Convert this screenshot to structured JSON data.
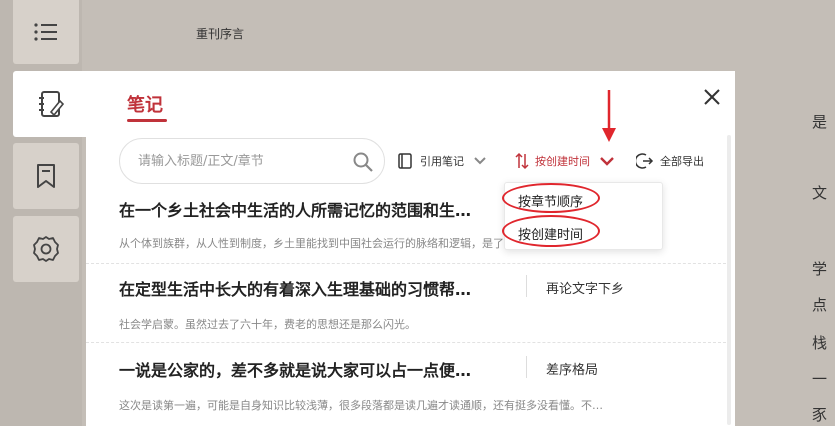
{
  "reader": {
    "chapter_title": "重刊序言",
    "edge_chars": [
      "是",
      "文",
      "学",
      "点",
      "栈",
      "一",
      "豕"
    ]
  },
  "sidebar": {
    "items": [
      {
        "name": "menu",
        "icon": "menu-icon"
      },
      {
        "name": "notes",
        "icon": "notes-icon",
        "active": true
      },
      {
        "name": "bookmark",
        "icon": "bookmark-icon"
      },
      {
        "name": "settings",
        "icon": "gear-icon"
      }
    ]
  },
  "panel": {
    "title": "笔记",
    "search": {
      "placeholder": "请输入标题/正文/章节"
    },
    "toolbar": {
      "cite_label": "引用笔记",
      "sort_label": "按创建时间",
      "export_label": "全部导出"
    },
    "sort_menu": {
      "options": [
        "按章节顺序",
        "按创建时间"
      ]
    },
    "notes": [
      {
        "title": "在一个乡土社会中生活的人所需记忆的范围和生…",
        "chapter": "",
        "excerpt": "从个体到族群，从人性到制度，乡土里能找到中国社会运行的脉络和逻辑，是了解中国社会的一把钥匙。乡土…"
      },
      {
        "title": "在定型生活中长大的有着深入生理基础的习惯帮…",
        "chapter": "再论文字下乡",
        "excerpt": "社会学启蒙。虽然过去了六十年，费老的思想还是那么闪光。"
      },
      {
        "title": "一说是公家的，差不多就是说大家可以占一点便…",
        "chapter": "差序格局",
        "excerpt": "这次是读第一遍，可能是自身知识比较浅薄，很多段落都是读几遍才读通顺，还有挺多没看懂。不…"
      }
    ]
  },
  "colors": {
    "accent": "#c0323a",
    "annotation": "#e0262d"
  }
}
